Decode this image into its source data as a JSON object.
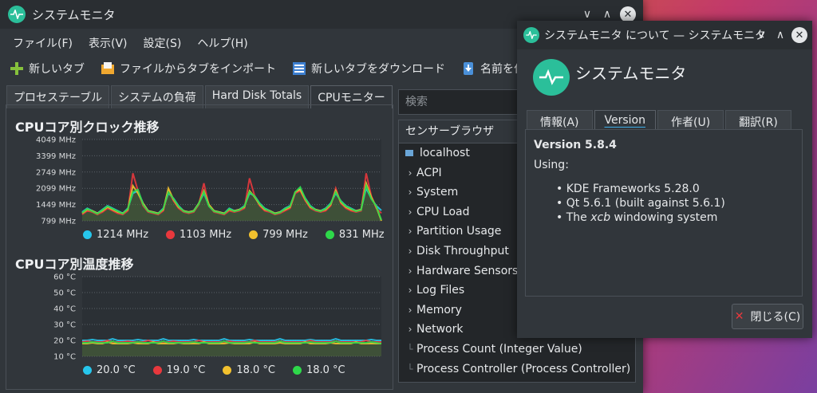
{
  "main": {
    "title": "システムモニタ",
    "menu": [
      "ファイル(F)",
      "表示(V)",
      "設定(S)",
      "ヘルプ(H)"
    ],
    "toolbar": [
      "新しいタブ",
      "ファイルからタブをインポート",
      "新しいタブをダウンロード",
      "名前を付けて"
    ],
    "tabs": [
      "プロセステーブル",
      "システムの負荷",
      "Hard Disk Totals",
      "CPUモニター"
    ],
    "active_tab": 3,
    "search_placeholder": "検索",
    "sensor_browser": {
      "header": "センサーブラウザ",
      "host": "localhost",
      "items": [
        "ACPI",
        "System",
        "CPU Load",
        "Partition Usage",
        "Disk Throughput",
        "Hardware Sensors",
        "Log Files",
        "Memory",
        "Network",
        "Process Count (Integer Value)",
        "Process Controller (Process Controller)"
      ]
    }
  },
  "colors": {
    "cyan": "#26c6ec",
    "red": "#e8383d",
    "yellow": "#f2c12e",
    "green": "#2ed84a"
  },
  "chart_data": [
    {
      "type": "line",
      "title": "CPUコア別クロック推移",
      "y_ticks": [
        "4049 MHz",
        "3399 MHz",
        "2749 MHz",
        "2099 MHz",
        "1449 MHz",
        "799 MHz"
      ],
      "ylim": [
        799,
        4049
      ],
      "x": [
        0,
        1,
        2,
        3,
        4,
        5,
        6,
        7,
        8,
        9,
        10,
        11,
        12,
        13,
        14,
        15,
        16,
        17,
        18,
        19,
        20,
        21,
        22,
        23,
        24,
        25,
        26,
        27,
        28,
        29,
        30,
        31,
        32,
        33,
        34,
        35,
        36,
        37,
        38,
        39,
        40,
        41,
        42,
        43,
        44,
        45,
        46,
        47,
        48,
        49,
        50,
        51,
        52,
        53,
        54,
        55,
        56,
        57,
        58,
        59
      ],
      "series": [
        {
          "name": "1214 MHz",
          "color": "#26c6ec",
          "values": [
            1150,
            1300,
            1200,
            1100,
            1250,
            1400,
            1300,
            1200,
            1100,
            1300,
            1900,
            2000,
            1500,
            1200,
            1150,
            1100,
            1300,
            1900,
            1700,
            1400,
            1200,
            1150,
            1200,
            1500,
            1900,
            1400,
            1200,
            1150,
            1100,
            1300,
            1200,
            1250,
            1400,
            1900,
            1800,
            1500,
            1300,
            1200,
            1100,
            1150,
            1300,
            1400,
            1900,
            2100,
            1700,
            1400,
            1250,
            1200,
            1300,
            1500,
            1900,
            1600,
            1400,
            1300,
            1200,
            1250,
            2100,
            1700,
            1400,
            1214
          ]
        },
        {
          "name": "1103 MHz",
          "color": "#e8383d",
          "values": [
            1050,
            1200,
            1150,
            1050,
            1150,
            1300,
            1200,
            1100,
            1050,
            1200,
            2700,
            2000,
            1400,
            1150,
            1100,
            1050,
            1200,
            2000,
            1600,
            1300,
            1150,
            1100,
            1150,
            1450,
            2300,
            1400,
            1150,
            1100,
            1050,
            1200,
            1150,
            1200,
            1300,
            2500,
            1800,
            1400,
            1200,
            1150,
            1050,
            1100,
            1200,
            1300,
            1900,
            2000,
            1600,
            1300,
            1200,
            1150,
            1200,
            1400,
            2100,
            1500,
            1300,
            1200,
            1150,
            1200,
            2700,
            1800,
            1300,
            1103
          ]
        },
        {
          "name": "799 MHz",
          "color": "#f2c12e",
          "values": [
            1100,
            1250,
            1200,
            1100,
            1200,
            1350,
            1250,
            1150,
            1100,
            1250,
            2200,
            1900,
            1500,
            1200,
            1150,
            1100,
            1250,
            2100,
            1650,
            1350,
            1200,
            1150,
            1200,
            1500,
            2000,
            1450,
            1200,
            1150,
            1100,
            1250,
            1200,
            1250,
            1350,
            2000,
            1750,
            1450,
            1250,
            1200,
            1100,
            1150,
            1250,
            1350,
            1950,
            2050,
            1650,
            1350,
            1250,
            1200,
            1250,
            1450,
            2000,
            1550,
            1350,
            1250,
            1200,
            1250,
            2300,
            1750,
            1350,
            799
          ]
        },
        {
          "name": "831 MHz",
          "color": "#2ed84a",
          "values": [
            1120,
            1280,
            1180,
            1080,
            1230,
            1380,
            1280,
            1180,
            1080,
            1280,
            1950,
            2050,
            1450,
            1180,
            1130,
            1080,
            1280,
            1950,
            1680,
            1380,
            1180,
            1130,
            1180,
            1480,
            1950,
            1380,
            1180,
            1130,
            1080,
            1280,
            1180,
            1230,
            1380,
            1950,
            1780,
            1480,
            1280,
            1180,
            1080,
            1130,
            1280,
            1380,
            1950,
            2150,
            1680,
            1380,
            1230,
            1180,
            1280,
            1480,
            1950,
            1580,
            1380,
            1280,
            1180,
            1230,
            2200,
            1680,
            1380,
            831
          ]
        }
      ]
    },
    {
      "type": "line",
      "title": "CPUコア別温度推移",
      "y_ticks": [
        "60 °C",
        "50 °C",
        "40 °C",
        "30 °C",
        "20 °C",
        "10 °C"
      ],
      "ylim": [
        10,
        60
      ],
      "x": [
        0,
        1,
        2,
        3,
        4,
        5,
        6,
        7,
        8,
        9,
        10,
        11,
        12,
        13,
        14,
        15,
        16,
        17,
        18,
        19,
        20,
        21,
        22,
        23,
        24,
        25,
        26,
        27,
        28,
        29,
        30,
        31,
        32,
        33,
        34,
        35,
        36,
        37,
        38,
        39,
        40,
        41,
        42,
        43,
        44,
        45,
        46,
        47,
        48,
        49,
        50,
        51,
        52,
        53,
        54,
        55,
        56,
        57,
        58,
        59
      ],
      "series": [
        {
          "name": "20.0 °C",
          "color": "#26c6ec",
          "values": [
            20,
            20,
            20.5,
            20,
            20,
            20,
            21,
            20,
            20,
            20,
            20,
            20.5,
            20,
            20,
            20,
            20,
            21,
            20,
            20,
            20,
            20,
            20,
            20.5,
            20,
            20,
            20,
            20,
            20,
            21,
            20,
            20,
            20,
            20,
            20.5,
            20,
            20,
            20,
            20,
            20,
            21,
            20,
            20,
            20,
            20,
            20,
            20.5,
            20,
            20,
            20,
            20,
            21,
            20,
            20,
            20,
            20,
            20,
            20,
            20.5,
            20,
            20
          ]
        },
        {
          "name": "19.0 °C",
          "color": "#e8383d",
          "values": [
            19,
            19.5,
            19,
            19,
            19,
            20,
            19,
            19,
            19,
            19.5,
            19,
            19,
            19,
            20,
            19,
            19,
            19,
            19,
            19.5,
            19,
            19,
            19,
            19,
            20,
            19,
            19,
            19,
            19,
            19,
            19.5,
            19,
            19,
            19,
            19,
            20,
            19,
            19,
            19,
            19,
            19.5,
            19,
            19,
            19,
            19,
            19,
            20,
            19,
            19,
            19,
            19,
            19.5,
            19,
            19,
            19,
            19,
            19,
            20,
            19,
            19,
            19
          ]
        },
        {
          "name": "18.0 °C",
          "color": "#f2c12e",
          "values": [
            18,
            18,
            18.5,
            18,
            18,
            19,
            18,
            18,
            18,
            18,
            18.5,
            18,
            18,
            18,
            19,
            18,
            18,
            18,
            18,
            18.5,
            18,
            18,
            18,
            18,
            19,
            18,
            18,
            18,
            18,
            18.5,
            18,
            18,
            18,
            18,
            19,
            18,
            18,
            18,
            18,
            18.5,
            18,
            18,
            18,
            18,
            19,
            18,
            18,
            18,
            18,
            18.5,
            18,
            18,
            18,
            18,
            19,
            18,
            18,
            18,
            18,
            18
          ]
        },
        {
          "name": "18.0 °C",
          "color": "#2ed84a",
          "values": [
            18.5,
            18.5,
            19,
            18.5,
            18.5,
            18.5,
            19.5,
            18.5,
            18.5,
            18.5,
            18.5,
            19,
            18.5,
            18.5,
            18.5,
            18.5,
            19.5,
            18.5,
            18.5,
            18.5,
            18.5,
            18.5,
            19,
            18.5,
            18.5,
            18.5,
            18.5,
            18.5,
            19.5,
            18.5,
            18.5,
            18.5,
            18.5,
            19,
            18.5,
            18.5,
            18.5,
            18.5,
            18.5,
            19.5,
            18.5,
            18.5,
            18.5,
            18.5,
            18.5,
            19,
            18.5,
            18.5,
            18.5,
            18.5,
            19.5,
            18.5,
            18.5,
            18.5,
            18.5,
            18.5,
            18.5,
            19,
            18.5,
            18
          ]
        }
      ]
    }
  ],
  "about": {
    "title": "システムモニタ について — システムモニタ",
    "app_name": "システムモニタ",
    "tabs": [
      "情報(A)",
      "Version",
      "作者(U)",
      "翻訳(R)"
    ],
    "active_tab": 1,
    "version": "Version 5.8.4",
    "using": "Using:",
    "libs": [
      {
        "plain": "KDE Frameworks 5.28.0"
      },
      {
        "plain": "Qt 5.6.1 (built against 5.6.1)"
      },
      {
        "pre": "The ",
        "em": "xcb",
        "post": " windowing system"
      }
    ],
    "close_label": "閉じる(C)"
  }
}
